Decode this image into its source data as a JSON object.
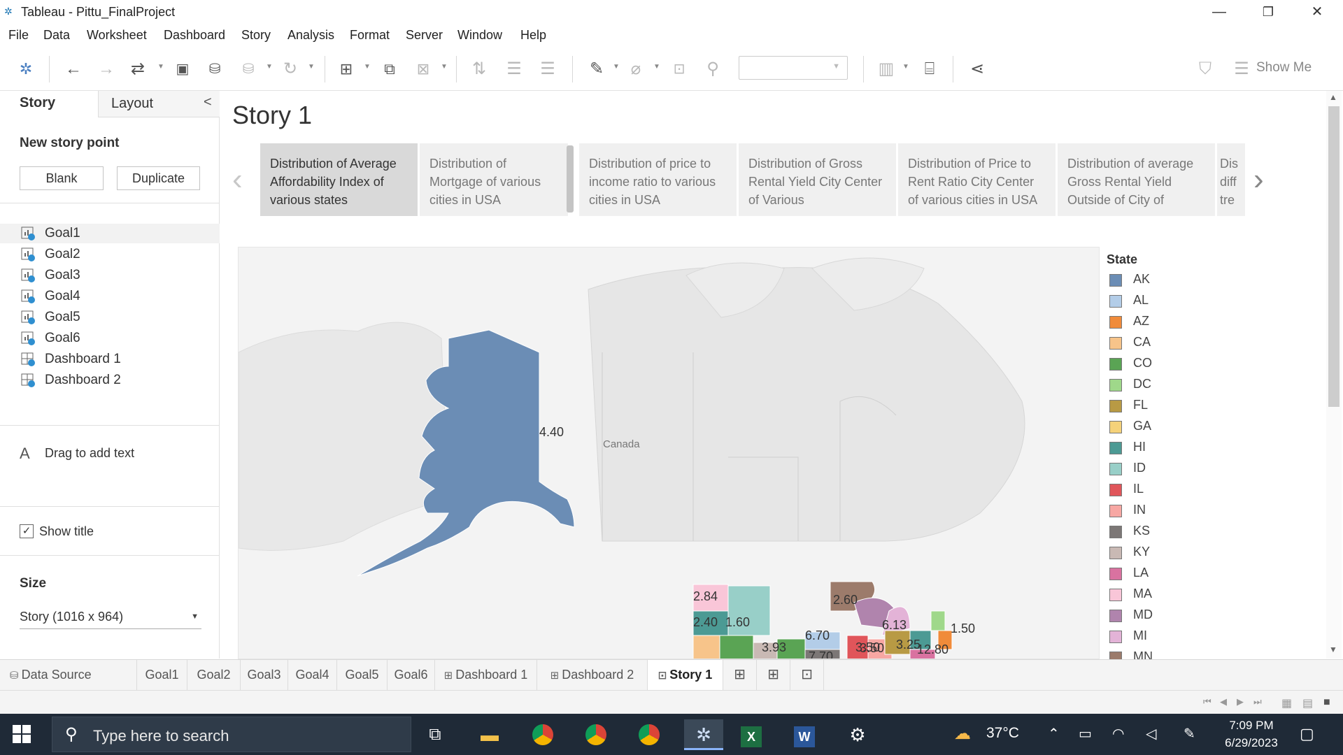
{
  "window": {
    "title": "Tableau - Pittu_FinalProject",
    "minimize": "—",
    "maximize": "❐",
    "close": "✕"
  },
  "menu": [
    "File",
    "Data",
    "Worksheet",
    "Dashboard",
    "Story",
    "Analysis",
    "Format",
    "Server",
    "Window",
    "Help"
  ],
  "toolbar": {
    "show_me": "Show Me",
    "format_select": ""
  },
  "left_panel": {
    "tab_story": "Story",
    "tab_layout": "Layout",
    "collapse": "<",
    "new_story_point": "New story point",
    "blank_button": "Blank",
    "duplicate_button": "Duplicate",
    "sheets": [
      {
        "label": "Goal1",
        "kind": "worksheet",
        "selected": true
      },
      {
        "label": "Goal2",
        "kind": "worksheet"
      },
      {
        "label": "Goal3",
        "kind": "worksheet"
      },
      {
        "label": "Goal4",
        "kind": "worksheet"
      },
      {
        "label": "Goal5",
        "kind": "worksheet"
      },
      {
        "label": "Goal6",
        "kind": "worksheet"
      },
      {
        "label": "Dashboard 1",
        "kind": "dashboard"
      },
      {
        "label": "Dashboard 2",
        "kind": "dashboard"
      }
    ],
    "text_icon": "A",
    "drag_text": "Drag to add text",
    "show_title_label": "Show title",
    "show_title_checked": true,
    "size_heading": "Size",
    "size_value": "Story (1016 x 964)"
  },
  "story": {
    "title": "Story 1",
    "points": [
      "Distribution of Average Affordability Index of various states",
      "Distribution of Mortgage of various cities in USA",
      "Distribution of  price to income ratio to various cities in USA",
      "Distribution of Gross Rental Yield City Center of Various",
      "Distribution of Price to Rent Ratio City Center of various cities in USA",
      "Distribution of average Gross Rental Yield Outside of City of",
      "Dis diff tre"
    ],
    "active_point": 0
  },
  "map": {
    "country_label": "Canada",
    "values": [
      {
        "state": "AK",
        "label": "4.40"
      },
      {
        "state": "",
        "label": "2.84"
      },
      {
        "state": "",
        "label": "2.40"
      },
      {
        "state": "",
        "label": "1.60"
      },
      {
        "state": "",
        "label": "2.60"
      },
      {
        "state": "",
        "label": "6.13"
      },
      {
        "state": "",
        "label": "1.50"
      },
      {
        "state": "",
        "label": "6.70"
      },
      {
        "state": "",
        "label": "3.50"
      },
      {
        "state": "",
        "label": "3.93"
      },
      {
        "state": "",
        "label": "7.70"
      },
      {
        "state": "",
        "label": "3.50"
      },
      {
        "state": "",
        "label": "3.25"
      },
      {
        "state": "",
        "label": "12.80"
      }
    ]
  },
  "legend": {
    "title": "State",
    "items": [
      {
        "code": "AK",
        "color": "#6b8db5"
      },
      {
        "code": "AL",
        "color": "#b3cde8"
      },
      {
        "code": "AZ",
        "color": "#f08b3a"
      },
      {
        "code": "CA",
        "color": "#f7c48a"
      },
      {
        "code": "CO",
        "color": "#5aa454"
      },
      {
        "code": "DC",
        "color": "#9fd88a"
      },
      {
        "code": "FL",
        "color": "#b89a44"
      },
      {
        "code": "GA",
        "color": "#f5d27a"
      },
      {
        "code": "HI",
        "color": "#4c9a94"
      },
      {
        "code": "ID",
        "color": "#98cfc8"
      },
      {
        "code": "IL",
        "color": "#e0555a"
      },
      {
        "code": "IN",
        "color": "#f7a7a3"
      },
      {
        "code": "KS",
        "color": "#7c7776"
      },
      {
        "code": "KY",
        "color": "#c9b9b4"
      },
      {
        "code": "LA",
        "color": "#d972a0"
      },
      {
        "code": "MA",
        "color": "#f9c6d8"
      },
      {
        "code": "MD",
        "color": "#b084ad"
      },
      {
        "code": "MI",
        "color": "#e3b3d7"
      },
      {
        "code": "MN",
        "color": "#9c7b6b"
      }
    ]
  },
  "sheet_tabs": {
    "data_source": "Data Source",
    "tabs": [
      {
        "label": "Goal1",
        "kind": "worksheet"
      },
      {
        "label": "Goal2",
        "kind": "worksheet"
      },
      {
        "label": "Goal3",
        "kind": "worksheet"
      },
      {
        "label": "Goal4",
        "kind": "worksheet"
      },
      {
        "label": "Goal5",
        "kind": "worksheet"
      },
      {
        "label": "Goal6",
        "kind": "worksheet"
      },
      {
        "label": "Dashboard 1",
        "kind": "dashboard"
      },
      {
        "label": "Dashboard 2",
        "kind": "dashboard"
      },
      {
        "label": "Story 1",
        "kind": "story",
        "active": true
      }
    ]
  },
  "taskbar": {
    "search_placeholder": "Type here to search",
    "weather": "37°C",
    "time": "7:09 PM",
    "date": "6/29/2023"
  }
}
